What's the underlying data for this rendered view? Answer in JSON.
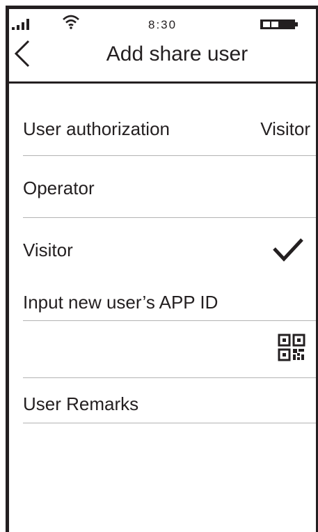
{
  "status_bar": {
    "time": "8:30",
    "signal_icon": "signal-bars-icon",
    "wifi_icon": "wifi-icon",
    "battery_icon": "battery-icon"
  },
  "nav": {
    "back_icon": "chevron-left-icon",
    "title": "Add share user"
  },
  "authorization": {
    "label": "User authorization",
    "value": "Visitor"
  },
  "options": [
    {
      "label": "Operator",
      "selected": false
    },
    {
      "label": "Visitor",
      "selected": true
    }
  ],
  "app_id": {
    "label": "Input new user’s APP ID",
    "scan_icon": "qr-code-icon"
  },
  "remarks": {
    "label": "User Remarks"
  },
  "colors": {
    "text": "#231f20",
    "divider": "#b3b3b3",
    "background": "#ffffff"
  }
}
